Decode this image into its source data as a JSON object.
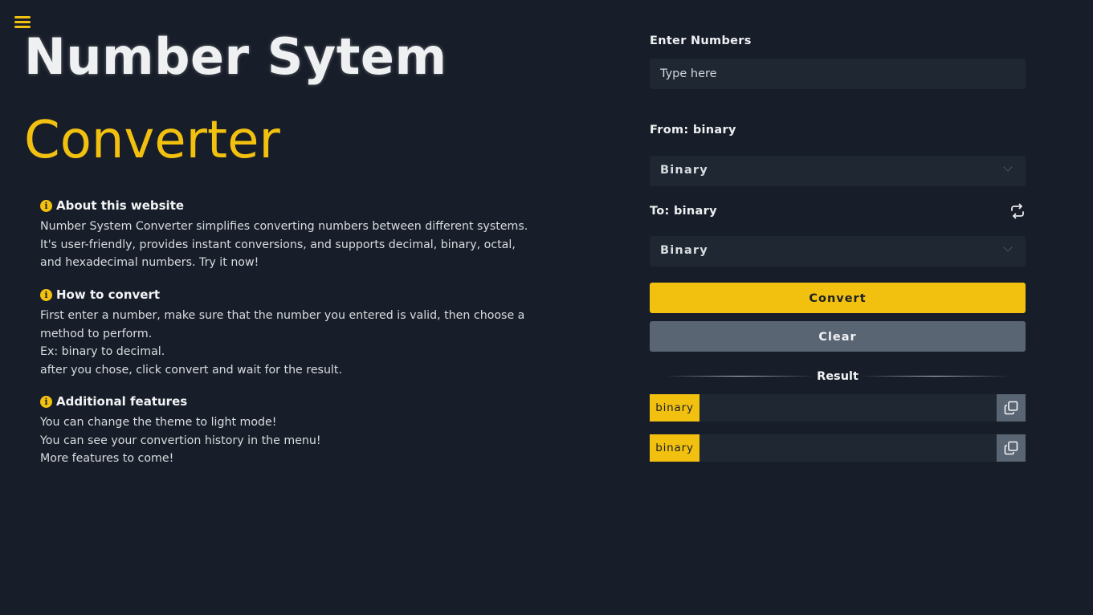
{
  "header": {
    "menu_icon": "hamburger-menu-icon",
    "title_main": "Number Sytem",
    "title_sub": "Converter"
  },
  "info": {
    "about": {
      "heading": "About this website",
      "body": "Number System Converter simplifies converting numbers between different systems. It's user-friendly, provides instant conversions, and supports decimal, binary, octal, and hexadecimal numbers. Try it now!"
    },
    "howto": {
      "heading": "How to convert",
      "lines": [
        "First enter a number, make sure that the number you entered is valid, then choose a method to perform.",
        "Ex: binary to decimal.",
        "after you chose, click convert and wait for the result."
      ]
    },
    "features": {
      "heading": "Additional features",
      "lines": [
        "You can change the theme to light mode!",
        "You can see your convertion history in the menu!",
        "More features to come!"
      ]
    },
    "icon_glyph": "i"
  },
  "form": {
    "input_label": "Enter Numbers",
    "input_placeholder": "Type here",
    "input_value": "",
    "from_label": "From: binary",
    "from_selected": "Binary",
    "to_label": "To: binary",
    "to_selected": "Binary",
    "swap_icon": "swap-arrows-icon",
    "convert_label": "Convert",
    "clear_label": "Clear"
  },
  "result": {
    "heading": "Result",
    "rows": [
      {
        "tag": "binary",
        "value": ""
      },
      {
        "tag": "binary",
        "value": ""
      }
    ],
    "copy_icon": "copy-icon"
  },
  "colors": {
    "background": "#181e29",
    "accent": "#f2c10f",
    "field": "#1f2733",
    "clear_button": "#596573"
  }
}
